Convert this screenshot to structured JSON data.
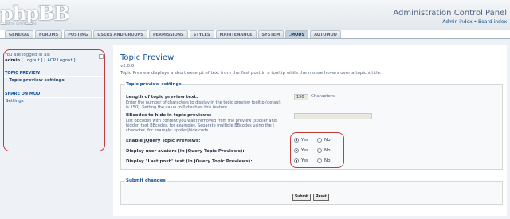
{
  "header": {
    "logo": "phpBB",
    "logo_tagline": "creating communities",
    "title": "Administration Control Panel",
    "links": "Admin index • Board index"
  },
  "tabs": [
    {
      "label": "General",
      "active": false
    },
    {
      "label": "Forums",
      "active": false
    },
    {
      "label": "Posting",
      "active": false
    },
    {
      "label": "Users and Groups",
      "active": false
    },
    {
      "label": "Permissions",
      "active": false
    },
    {
      "label": "Styles",
      "active": false
    },
    {
      "label": "Maintenance",
      "active": false
    },
    {
      "label": "System",
      "active": false
    },
    {
      "label": ".MODs",
      "active": true
    },
    {
      "label": "Automod",
      "active": false
    }
  ],
  "sidebar": {
    "collapse_icon": "minus-icon",
    "logged_in_as": "You are logged in as:",
    "username": "admin",
    "logout": "[ Logout ]",
    "acp_logout": "[ ACP Logout ]",
    "sections": [
      {
        "title": "Topic Preview",
        "items": [
          {
            "label": "Topic preview settings",
            "active": true
          }
        ]
      },
      {
        "title": "Share On MOD",
        "items": [
          {
            "label": "Settings",
            "active": false
          }
        ]
      }
    ]
  },
  "main": {
    "title": "Topic Preview",
    "version": "v2.0.0",
    "description": "Topic Preview displays a short excerpt of text from the first post in a tooltip while the mouse hovers over a topic’s title.",
    "settings": {
      "legend": "Topic preview settings",
      "length_label": "Length of topic preview text:",
      "length_explain": "Enter the number of characters to display in the topic preview tooltip (default is 150). Setting the value to 0 disables this feature.",
      "length_value": "150",
      "length_unit": "Characters",
      "bbcodes_label": "BBcodes to hide in topic previews:",
      "bbcodes_explain": "List BBcodes with content you want removed from the preview (spoiler and hidden text BBcodes, for example). Separate multiple BBcodes using the | character, for example: spoiler|hide|code",
      "bbcodes_value": "",
      "jquery_label": "Enable jQuery Topic Previews:",
      "avatars_label": "Display user avatars (in jQuery Topic Previews):",
      "lastpost_label": "Display \"Last post\" text (in jQuery Topic Previews):",
      "yes_label": "Yes",
      "no_label": "No",
      "jquery_value": "Yes",
      "avatars_value": "Yes",
      "lastpost_value": "Yes"
    },
    "submit": {
      "legend": "Submit changes",
      "submit_label": "Submit",
      "reset_label": "Reset"
    }
  },
  "colors": {
    "accent": "#115098",
    "highlight_outline": "#c23a3a",
    "panel_bg": "#eef2f6"
  }
}
